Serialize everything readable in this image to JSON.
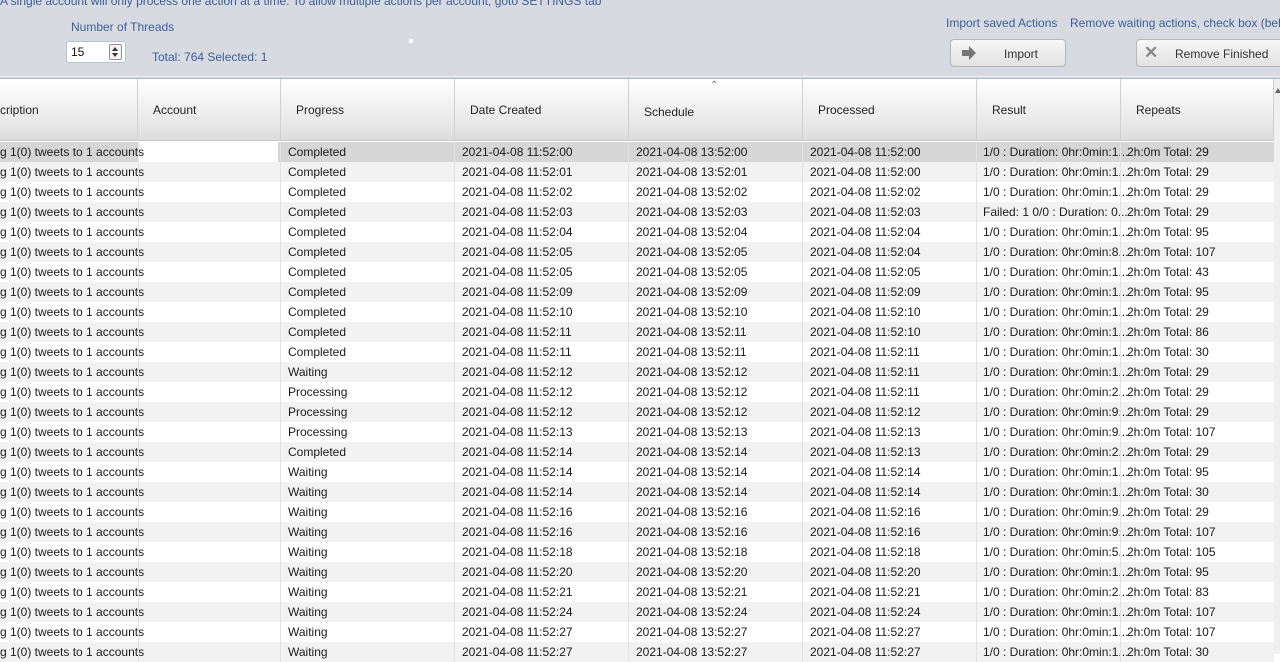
{
  "top": {
    "note": "A single account will only process one action at a time. To allow multiple actions per account, goto SETTINGS tab",
    "threads_label": "Number of Threads",
    "threads_value": "15",
    "total_text": "Total: 764 Selected: 1",
    "import_label": "Import saved Actions",
    "remove_label": "Remove waiting actions, check box (bel",
    "import_button": "Import",
    "remove_button": "Remove Finished"
  },
  "columns": [
    "cription",
    "Account",
    "Progress",
    "Date Created",
    "Schedule",
    "Processed",
    "Result",
    "Repeats"
  ],
  "rows": [
    {
      "d": "g 1(0) tweets to 1 accounts",
      "a": "",
      "p": "Completed",
      "c": "2021-04-08 11:52:00",
      "s": "2021-04-08 13:52:00",
      "pr": "2021-04-08 11:52:00",
      "r": "1/0 : Duration: 0hr:0min:1...",
      "rep": "2h:0m Total: 29"
    },
    {
      "d": "g 1(0) tweets to 1 accounts",
      "a": "",
      "p": "Completed",
      "c": "2021-04-08 11:52:01",
      "s": "2021-04-08 13:52:01",
      "pr": "2021-04-08 11:52:00",
      "r": "1/0 : Duration: 0hr:0min:1...",
      "rep": "2h:0m Total: 29"
    },
    {
      "d": "g 1(0) tweets to 1 accounts",
      "a": "",
      "p": "Completed",
      "c": "2021-04-08 11:52:02",
      "s": "2021-04-08 13:52:02",
      "pr": "2021-04-08 11:52:02",
      "r": "1/0 : Duration: 0hr:0min:1...",
      "rep": "2h:0m Total: 29"
    },
    {
      "d": "g 1(0) tweets to 1 accounts",
      "a": "",
      "p": "Completed",
      "c": "2021-04-08 11:52:03",
      "s": "2021-04-08 13:52:03",
      "pr": "2021-04-08 11:52:03",
      "r": "Failed: 1 0/0 : Duration: 0...",
      "rep": "2h:0m Total: 29"
    },
    {
      "d": "g 1(0) tweets to 1 accounts",
      "a": "",
      "p": "Completed",
      "c": "2021-04-08 11:52:04",
      "s": "2021-04-08 13:52:04",
      "pr": "2021-04-08 11:52:04",
      "r": "1/0 : Duration: 0hr:0min:1...",
      "rep": "2h:0m Total: 95"
    },
    {
      "d": "g 1(0) tweets to 1 accounts",
      "a": "",
      "p": "Completed",
      "c": "2021-04-08 11:52:05",
      "s": "2021-04-08 13:52:05",
      "pr": "2021-04-08 11:52:04",
      "r": "1/0 : Duration: 0hr:0min:8...",
      "rep": "2h:0m Total: 107"
    },
    {
      "d": "g 1(0) tweets to 1 accounts",
      "a": "",
      "p": "Completed",
      "c": "2021-04-08 11:52:05",
      "s": "2021-04-08 13:52:05",
      "pr": "2021-04-08 11:52:05",
      "r": "1/0 : Duration: 0hr:0min:1...",
      "rep": "2h:0m Total: 43"
    },
    {
      "d": "g 1(0) tweets to 1 accounts",
      "a": "",
      "p": "Completed",
      "c": "2021-04-08 11:52:09",
      "s": "2021-04-08 13:52:09",
      "pr": "2021-04-08 11:52:09",
      "r": "1/0 : Duration: 0hr:0min:1...",
      "rep": "2h:0m Total: 95"
    },
    {
      "d": "g 1(0) tweets to 1 accounts",
      "a": "",
      "p": "Completed",
      "c": "2021-04-08 11:52:10",
      "s": "2021-04-08 13:52:10",
      "pr": "2021-04-08 11:52:10",
      "r": "1/0 : Duration: 0hr:0min:1...",
      "rep": "2h:0m Total: 29"
    },
    {
      "d": "g 1(0) tweets to 1 accounts",
      "a": "",
      "p": "Completed",
      "c": "2021-04-08 11:52:11",
      "s": "2021-04-08 13:52:11",
      "pr": "2021-04-08 11:52:10",
      "r": "1/0 : Duration: 0hr:0min:1...",
      "rep": "2h:0m Total: 86"
    },
    {
      "d": "g 1(0) tweets to 1 accounts",
      "a": "",
      "p": "Completed",
      "c": "2021-04-08 11:52:11",
      "s": "2021-04-08 13:52:11",
      "pr": "2021-04-08 11:52:11",
      "r": "1/0 : Duration: 0hr:0min:1...",
      "rep": "2h:0m Total: 30"
    },
    {
      "d": "g 1(0) tweets to 1 accounts",
      "a": "",
      "p": "Waiting",
      "c": "2021-04-08 11:52:12",
      "s": "2021-04-08 13:52:12",
      "pr": "2021-04-08 11:52:11",
      "r": "1/0 : Duration: 0hr:0min:1...",
      "rep": "2h:0m Total: 29"
    },
    {
      "d": "g 1(0) tweets to 1 accounts",
      "a": "",
      "p": "Processing",
      "c": "2021-04-08 11:52:12",
      "s": "2021-04-08 13:52:12",
      "pr": "2021-04-08 11:52:11",
      "r": "1/0 : Duration: 0hr:0min:2...",
      "rep": "2h:0m Total: 29"
    },
    {
      "d": "g 1(0) tweets to 1 accounts",
      "a": "",
      "p": "Processing",
      "c": "2021-04-08 11:52:12",
      "s": "2021-04-08 13:52:12",
      "pr": "2021-04-08 11:52:12",
      "r": "1/0 : Duration: 0hr:0min:9...",
      "rep": "2h:0m Total: 29"
    },
    {
      "d": "g 1(0) tweets to 1 accounts",
      "a": "",
      "p": "Processing",
      "c": "2021-04-08 11:52:13",
      "s": "2021-04-08 13:52:13",
      "pr": "2021-04-08 11:52:13",
      "r": "1/0 : Duration: 0hr:0min:9...",
      "rep": "2h:0m Total: 107"
    },
    {
      "d": "g 1(0) tweets to 1 accounts",
      "a": "",
      "p": "Completed",
      "c": "2021-04-08 11:52:14",
      "s": "2021-04-08 13:52:14",
      "pr": "2021-04-08 11:52:13",
      "r": "1/0 : Duration: 0hr:0min:2...",
      "rep": "2h:0m Total: 29"
    },
    {
      "d": "g 1(0) tweets to 1 accounts",
      "a": "",
      "p": "Waiting",
      "c": "2021-04-08 11:52:14",
      "s": "2021-04-08 13:52:14",
      "pr": "2021-04-08 11:52:14",
      "r": "1/0 : Duration: 0hr:0min:1...",
      "rep": "2h:0m Total: 95"
    },
    {
      "d": "g 1(0) tweets to 1 accounts",
      "a": "",
      "p": "Waiting",
      "c": "2021-04-08 11:52:14",
      "s": "2021-04-08 13:52:14",
      "pr": "2021-04-08 11:52:14",
      "r": "1/0 : Duration: 0hr:0min:1...",
      "rep": "2h:0m Total: 30"
    },
    {
      "d": "g 1(0) tweets to 1 accounts",
      "a": "",
      "p": "Waiting",
      "c": "2021-04-08 11:52:16",
      "s": "2021-04-08 13:52:16",
      "pr": "2021-04-08 11:52:16",
      "r": "1/0 : Duration: 0hr:0min:9...",
      "rep": "2h:0m Total: 29"
    },
    {
      "d": "g 1(0) tweets to 1 accounts",
      "a": "",
      "p": "Waiting",
      "c": "2021-04-08 11:52:16",
      "s": "2021-04-08 13:52:16",
      "pr": "2021-04-08 11:52:16",
      "r": "1/0 : Duration: 0hr:0min:9...",
      "rep": "2h:0m Total: 107"
    },
    {
      "d": "g 1(0) tweets to 1 accounts",
      "a": "",
      "p": "Waiting",
      "c": "2021-04-08 11:52:18",
      "s": "2021-04-08 13:52:18",
      "pr": "2021-04-08 11:52:18",
      "r": "1/0 : Duration: 0hr:0min:5...",
      "rep": "2h:0m Total: 105"
    },
    {
      "d": "g 1(0) tweets to 1 accounts",
      "a": "",
      "p": "Waiting",
      "c": "2021-04-08 11:52:20",
      "s": "2021-04-08 13:52:20",
      "pr": "2021-04-08 11:52:20",
      "r": "1/0 : Duration: 0hr:0min:1...",
      "rep": "2h:0m Total: 95"
    },
    {
      "d": "g 1(0) tweets to 1 accounts",
      "a": "",
      "p": "Waiting",
      "c": "2021-04-08 11:52:21",
      "s": "2021-04-08 13:52:21",
      "pr": "2021-04-08 11:52:21",
      "r": "1/0 : Duration: 0hr:0min:2...",
      "rep": "2h:0m Total: 83"
    },
    {
      "d": "g 1(0) tweets to 1 accounts",
      "a": "",
      "p": "Waiting",
      "c": "2021-04-08 11:52:24",
      "s": "2021-04-08 13:52:24",
      "pr": "2021-04-08 11:52:24",
      "r": "1/0 : Duration: 0hr:0min:1...",
      "rep": "2h:0m Total: 107"
    },
    {
      "d": "g 1(0) tweets to 1 accounts",
      "a": "",
      "p": "Waiting",
      "c": "2021-04-08 11:52:27",
      "s": "2021-04-08 13:52:27",
      "pr": "2021-04-08 11:52:27",
      "r": "1/0 : Duration: 0hr:0min:1...",
      "rep": "2h:0m Total: 107"
    },
    {
      "d": "g 1(0) tweets to 1 accounts",
      "a": "",
      "p": "Waiting",
      "c": "2021-04-08 11:52:27",
      "s": "2021-04-08 13:52:27",
      "pr": "2021-04-08 11:52:27",
      "r": "1/0 : Duration: 0hr:0min:1...",
      "rep": "2h:0m Total: 30"
    }
  ],
  "selected_row": 0,
  "colors": {
    "accent_text": "#3c5f98",
    "panel_bg": "#d7dbe1",
    "selected_row": "#d6d6d6"
  }
}
